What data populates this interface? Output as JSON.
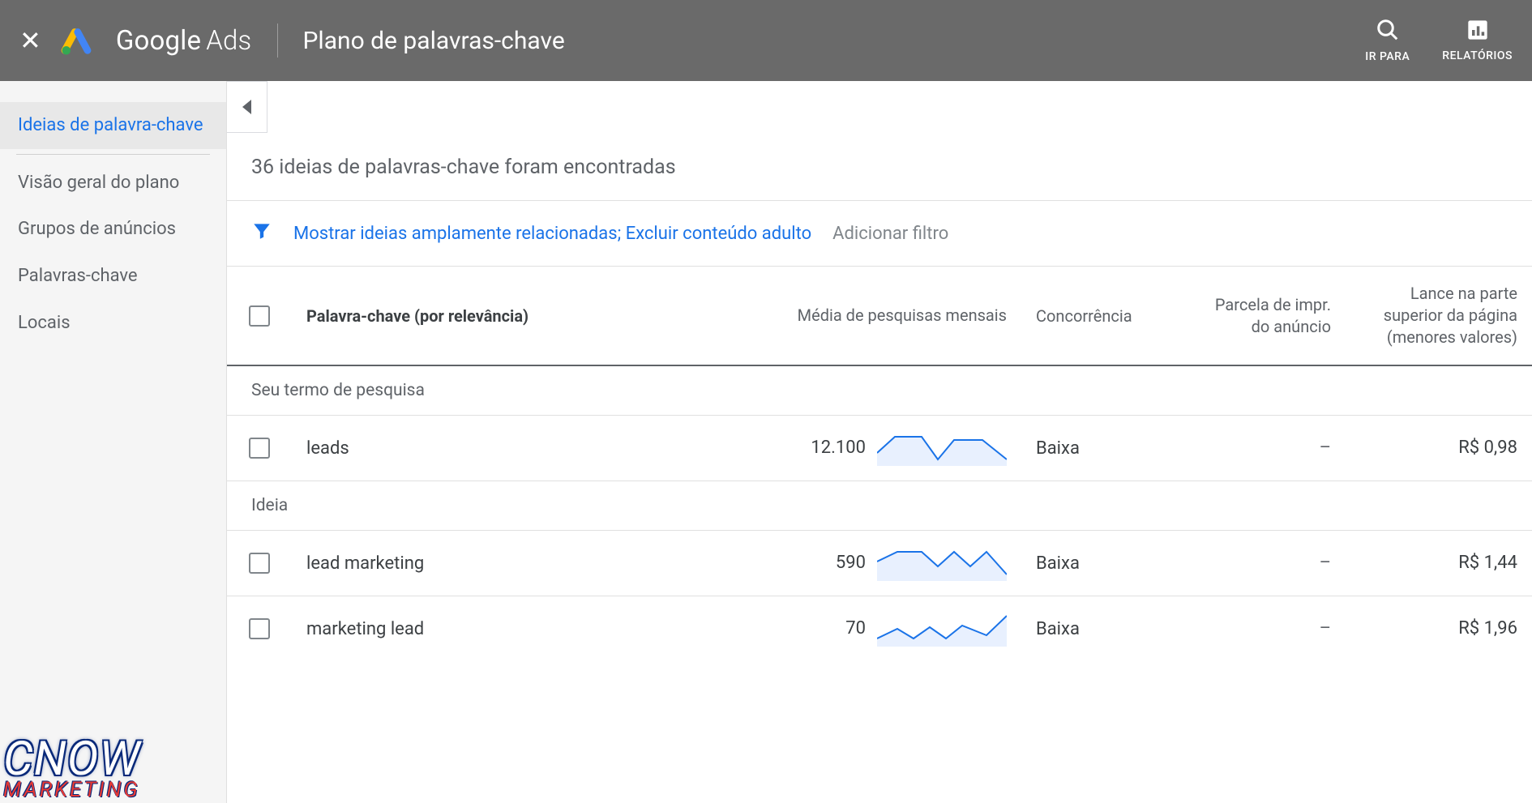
{
  "header": {
    "brand_first": "Google",
    "brand_second": "Ads",
    "plan_title": "Plano de palavras-chave",
    "goto_label": "IR PARA",
    "reports_label": "RELATÓRIOS"
  },
  "sidebar": {
    "items": [
      {
        "label": "Ideias de palavra-chave",
        "active": true
      },
      {
        "label": "Visão geral do plano",
        "active": false
      },
      {
        "label": "Grupos de anúncios",
        "active": false
      },
      {
        "label": "Palavras-chave",
        "active": false
      },
      {
        "label": "Locais",
        "active": false
      }
    ]
  },
  "main": {
    "ideas_found": "36 ideias de palavras-chave foram encontradas",
    "filter_active": "Mostrar ideias amplamente relacionadas; Excluir conteúdo adulto",
    "filter_add": "Adicionar filtro",
    "columns": {
      "keyword": "Palavra-chave (por relevância)",
      "searches": "Média de pesquisas mensais",
      "competition": "Concorrência",
      "impshare": "Parcela de impr. do anúncio",
      "bid_low": "Lance na parte superior da página (menores valores)"
    },
    "section_search_term": "Seu termo de pesquisa",
    "section_idea": "Ideia",
    "rows_search": [
      {
        "keyword": "leads",
        "searches": "12.100",
        "competition": "Baixa",
        "impshare": "–",
        "bid": "R$ 0,98"
      }
    ],
    "rows_idea": [
      {
        "keyword": "lead marketing",
        "searches": "590",
        "competition": "Baixa",
        "impshare": "–",
        "bid": "R$ 1,44"
      },
      {
        "keyword": "marketing lead",
        "searches": "70",
        "competition": "Baixa",
        "impshare": "–",
        "bid": "R$ 1,96"
      }
    ]
  },
  "watermark": {
    "line1": "CNOW",
    "line2": "MARKETING"
  }
}
